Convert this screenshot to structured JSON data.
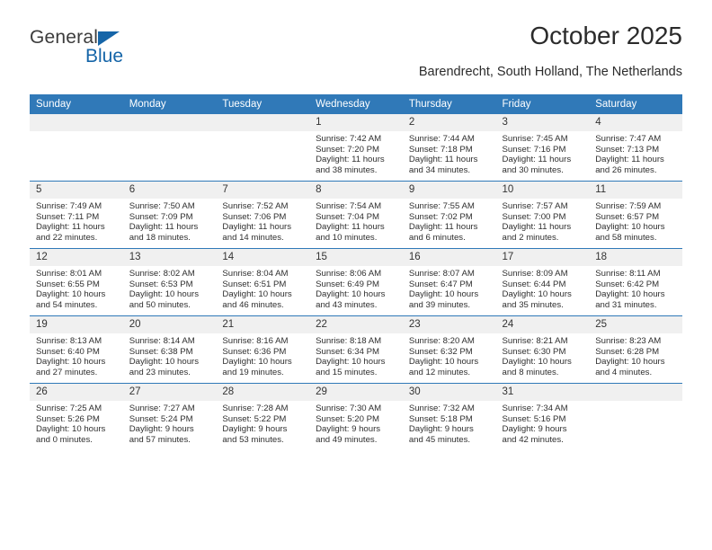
{
  "brand": {
    "name_top": "General",
    "name_bottom": "Blue",
    "accent_color": "#1565a8",
    "triangle_icon": "brand-triangle-icon"
  },
  "header": {
    "title": "October 2025",
    "subtitle": "Barendrecht, South Holland, The Netherlands"
  },
  "theme": {
    "header_blue": "#3079b8",
    "daynum_background": "#f0f0f0",
    "text_color": "#2f2f2f"
  },
  "calendar": {
    "weekday_headers": [
      "Sunday",
      "Monday",
      "Tuesday",
      "Wednesday",
      "Thursday",
      "Friday",
      "Saturday"
    ],
    "labels": {
      "sunrise": "Sunrise:",
      "sunset": "Sunset:",
      "daylight": "Daylight:"
    },
    "weeks": [
      [
        {
          "day": "",
          "empty": true
        },
        {
          "day": "",
          "empty": true
        },
        {
          "day": "",
          "empty": true
        },
        {
          "day": "1",
          "sunrise": "Sunrise: 7:42 AM",
          "sunset": "Sunset: 7:20 PM",
          "daylight_line1": "Daylight: 11 hours",
          "daylight_line2": "and 38 minutes."
        },
        {
          "day": "2",
          "sunrise": "Sunrise: 7:44 AM",
          "sunset": "Sunset: 7:18 PM",
          "daylight_line1": "Daylight: 11 hours",
          "daylight_line2": "and 34 minutes."
        },
        {
          "day": "3",
          "sunrise": "Sunrise: 7:45 AM",
          "sunset": "Sunset: 7:16 PM",
          "daylight_line1": "Daylight: 11 hours",
          "daylight_line2": "and 30 minutes."
        },
        {
          "day": "4",
          "sunrise": "Sunrise: 7:47 AM",
          "sunset": "Sunset: 7:13 PM",
          "daylight_line1": "Daylight: 11 hours",
          "daylight_line2": "and 26 minutes."
        }
      ],
      [
        {
          "day": "5",
          "sunrise": "Sunrise: 7:49 AM",
          "sunset": "Sunset: 7:11 PM",
          "daylight_line1": "Daylight: 11 hours",
          "daylight_line2": "and 22 minutes."
        },
        {
          "day": "6",
          "sunrise": "Sunrise: 7:50 AM",
          "sunset": "Sunset: 7:09 PM",
          "daylight_line1": "Daylight: 11 hours",
          "daylight_line2": "and 18 minutes."
        },
        {
          "day": "7",
          "sunrise": "Sunrise: 7:52 AM",
          "sunset": "Sunset: 7:06 PM",
          "daylight_line1": "Daylight: 11 hours",
          "daylight_line2": "and 14 minutes."
        },
        {
          "day": "8",
          "sunrise": "Sunrise: 7:54 AM",
          "sunset": "Sunset: 7:04 PM",
          "daylight_line1": "Daylight: 11 hours",
          "daylight_line2": "and 10 minutes."
        },
        {
          "day": "9",
          "sunrise": "Sunrise: 7:55 AM",
          "sunset": "Sunset: 7:02 PM",
          "daylight_line1": "Daylight: 11 hours",
          "daylight_line2": "and 6 minutes."
        },
        {
          "day": "10",
          "sunrise": "Sunrise: 7:57 AM",
          "sunset": "Sunset: 7:00 PM",
          "daylight_line1": "Daylight: 11 hours",
          "daylight_line2": "and 2 minutes."
        },
        {
          "day": "11",
          "sunrise": "Sunrise: 7:59 AM",
          "sunset": "Sunset: 6:57 PM",
          "daylight_line1": "Daylight: 10 hours",
          "daylight_line2": "and 58 minutes."
        }
      ],
      [
        {
          "day": "12",
          "sunrise": "Sunrise: 8:01 AM",
          "sunset": "Sunset: 6:55 PM",
          "daylight_line1": "Daylight: 10 hours",
          "daylight_line2": "and 54 minutes."
        },
        {
          "day": "13",
          "sunrise": "Sunrise: 8:02 AM",
          "sunset": "Sunset: 6:53 PM",
          "daylight_line1": "Daylight: 10 hours",
          "daylight_line2": "and 50 minutes."
        },
        {
          "day": "14",
          "sunrise": "Sunrise: 8:04 AM",
          "sunset": "Sunset: 6:51 PM",
          "daylight_line1": "Daylight: 10 hours",
          "daylight_line2": "and 46 minutes."
        },
        {
          "day": "15",
          "sunrise": "Sunrise: 8:06 AM",
          "sunset": "Sunset: 6:49 PM",
          "daylight_line1": "Daylight: 10 hours",
          "daylight_line2": "and 43 minutes."
        },
        {
          "day": "16",
          "sunrise": "Sunrise: 8:07 AM",
          "sunset": "Sunset: 6:47 PM",
          "daylight_line1": "Daylight: 10 hours",
          "daylight_line2": "and 39 minutes."
        },
        {
          "day": "17",
          "sunrise": "Sunrise: 8:09 AM",
          "sunset": "Sunset: 6:44 PM",
          "daylight_line1": "Daylight: 10 hours",
          "daylight_line2": "and 35 minutes."
        },
        {
          "day": "18",
          "sunrise": "Sunrise: 8:11 AM",
          "sunset": "Sunset: 6:42 PM",
          "daylight_line1": "Daylight: 10 hours",
          "daylight_line2": "and 31 minutes."
        }
      ],
      [
        {
          "day": "19",
          "sunrise": "Sunrise: 8:13 AM",
          "sunset": "Sunset: 6:40 PM",
          "daylight_line1": "Daylight: 10 hours",
          "daylight_line2": "and 27 minutes."
        },
        {
          "day": "20",
          "sunrise": "Sunrise: 8:14 AM",
          "sunset": "Sunset: 6:38 PM",
          "daylight_line1": "Daylight: 10 hours",
          "daylight_line2": "and 23 minutes."
        },
        {
          "day": "21",
          "sunrise": "Sunrise: 8:16 AM",
          "sunset": "Sunset: 6:36 PM",
          "daylight_line1": "Daylight: 10 hours",
          "daylight_line2": "and 19 minutes."
        },
        {
          "day": "22",
          "sunrise": "Sunrise: 8:18 AM",
          "sunset": "Sunset: 6:34 PM",
          "daylight_line1": "Daylight: 10 hours",
          "daylight_line2": "and 15 minutes."
        },
        {
          "day": "23",
          "sunrise": "Sunrise: 8:20 AM",
          "sunset": "Sunset: 6:32 PM",
          "daylight_line1": "Daylight: 10 hours",
          "daylight_line2": "and 12 minutes."
        },
        {
          "day": "24",
          "sunrise": "Sunrise: 8:21 AM",
          "sunset": "Sunset: 6:30 PM",
          "daylight_line1": "Daylight: 10 hours",
          "daylight_line2": "and 8 minutes."
        },
        {
          "day": "25",
          "sunrise": "Sunrise: 8:23 AM",
          "sunset": "Sunset: 6:28 PM",
          "daylight_line1": "Daylight: 10 hours",
          "daylight_line2": "and 4 minutes."
        }
      ],
      [
        {
          "day": "26",
          "sunrise": "Sunrise: 7:25 AM",
          "sunset": "Sunset: 5:26 PM",
          "daylight_line1": "Daylight: 10 hours",
          "daylight_line2": "and 0 minutes."
        },
        {
          "day": "27",
          "sunrise": "Sunrise: 7:27 AM",
          "sunset": "Sunset: 5:24 PM",
          "daylight_line1": "Daylight: 9 hours",
          "daylight_line2": "and 57 minutes."
        },
        {
          "day": "28",
          "sunrise": "Sunrise: 7:28 AM",
          "sunset": "Sunset: 5:22 PM",
          "daylight_line1": "Daylight: 9 hours",
          "daylight_line2": "and 53 minutes."
        },
        {
          "day": "29",
          "sunrise": "Sunrise: 7:30 AM",
          "sunset": "Sunset: 5:20 PM",
          "daylight_line1": "Daylight: 9 hours",
          "daylight_line2": "and 49 minutes."
        },
        {
          "day": "30",
          "sunrise": "Sunrise: 7:32 AM",
          "sunset": "Sunset: 5:18 PM",
          "daylight_line1": "Daylight: 9 hours",
          "daylight_line2": "and 45 minutes."
        },
        {
          "day": "31",
          "sunrise": "Sunrise: 7:34 AM",
          "sunset": "Sunset: 5:16 PM",
          "daylight_line1": "Daylight: 9 hours",
          "daylight_line2": "and 42 minutes."
        },
        {
          "day": "",
          "empty": true
        }
      ]
    ]
  }
}
